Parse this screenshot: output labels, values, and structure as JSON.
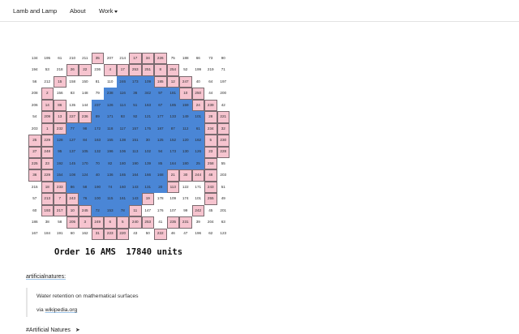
{
  "nav": {
    "brand": "Lamb and Lamp",
    "about": "About",
    "work": "Work"
  },
  "colors": {
    "water": "#4a86d6",
    "dry": "#f6c4cf",
    "outside": "#ffffff"
  },
  "grid": {
    "values": [
      [
        134,
        195,
        61,
        210,
        211,
        35,
        207,
        214,
        17,
        34,
        226,
        75,
        188,
        66,
        73,
        90
      ],
      [
        194,
        53,
        218,
        26,
        22,
        236,
        4,
        17,
        253,
        251,
        8,
        254,
        52,
        199,
        219,
        71
      ],
      [
        56,
        212,
        15,
        158,
        150,
        81,
        110,
        246,
        173,
        109,
        185,
        12,
        247,
        40,
        64,
        197
      ],
      [
        208,
        2,
        156,
        83,
        148,
        79,
        238,
        116,
        36,
        342,
        97,
        181,
        10,
        250,
        44,
        200
      ],
      [
        206,
        14,
        86,
        135,
        144,
        237,
        126,
        114,
        51,
        163,
        67,
        185,
        159,
        24,
        239,
        42
      ],
      [
        54,
        209,
        13,
        227,
        236,
        89,
        171,
        93,
        92,
        121,
        177,
        133,
        149,
        101,
        28,
        221
      ],
      [
        203,
        1,
        232,
        77,
        98,
        172,
        118,
        117,
        157,
        175,
        187,
        87,
        112,
        61,
        234,
        32
      ],
      [
        25,
        229,
        128,
        127,
        84,
        163,
        155,
        138,
        151,
        30,
        125,
        152,
        120,
        162,
        5,
        230
      ],
      [
        27,
        248,
        95,
        137,
        105,
        132,
        196,
        106,
        113,
        102,
        94,
        173,
        130,
        126,
        23,
        228
      ],
      [
        225,
        23,
        192,
        145,
        170,
        70,
        82,
        180,
        190,
        139,
        85,
        164,
        180,
        25,
        258,
        55
      ],
      [
        36,
        229,
        154,
        108,
        124,
        40,
        136,
        165,
        164,
        166,
        168,
        21,
        30,
        244,
        48,
        203
      ],
      [
        215,
        18,
        233,
        86,
        58,
        190,
        74,
        160,
        143,
        131,
        20,
        113,
        122,
        171,
        243,
        51
      ],
      [
        57,
        213,
        7,
        243,
        76,
        100,
        115,
        161,
        143,
        19,
        178,
        109,
        174,
        101,
        255,
        49
      ],
      [
        60,
        193,
        217,
        10,
        245,
        72,
        153,
        78,
        11,
        147,
        176,
        107,
        99,
        242,
        45,
        201
      ],
      [
        186,
        38,
        58,
        205,
        3,
        249,
        6,
        5,
        240,
        253,
        41,
        235,
        231,
        39,
        204,
        63
      ],
      [
        167,
        184,
        191,
        60,
        162,
        31,
        223,
        220,
        43,
        50,
        222,
        46,
        47,
        196,
        62,
        123
      ]
    ],
    "states": [
      "OOOOODOODDDOOOOO",
      "OOODDODDDDDDOOOO",
      "OODOOOOWWWDDDOOO",
      "ODOOOOWWWWWWDDOO",
      "ODDOOWWWWWWWWDDO",
      "ODDDDWWWWWWWWWDD",
      "ODDWWWWWWWWWWWDD",
      "DDWWWWWWWWWWWWDD",
      "DDWWWWWWWWWWWWDD",
      "DDWWWWWWWWWWWWDO",
      "DDWWWWWWWWWDDDDO",
      "ODDWWWWWWWWDOODO",
      "ODDDWWWWWDOOOODO",
      "ODDDDWWWDOOOODOO",
      "OOODDDDDDDODDOOO",
      "OOOOODDDOODOOOOO"
    ]
  },
  "caption": "Order 16 AMS  17840 units",
  "source_link": "artificialnatures:",
  "quote": {
    "text": "Water retention on mathematical surfaces",
    "via_prefix": "via ",
    "via_link": "wikipedia.org"
  },
  "tag": "#Artificial Natures"
}
